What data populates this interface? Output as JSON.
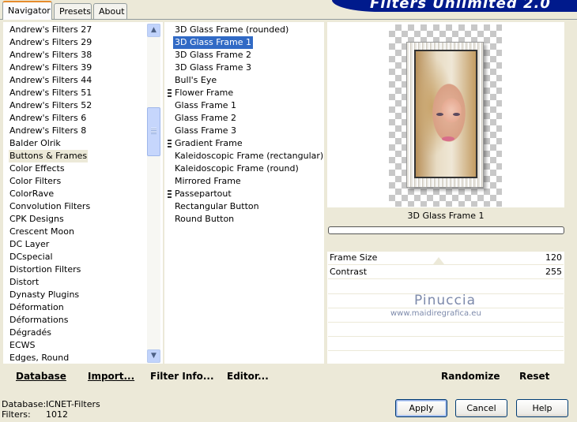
{
  "tabs": [
    "Navigator",
    "Presets",
    "About"
  ],
  "banner_title": "Filters Unlimited 2.0",
  "categories": [
    "Andrew's Filters 27",
    "Andrew's Filters 29",
    "Andrew's Filters 38",
    "Andrew's Filters 39",
    "Andrew's Filters 44",
    "Andrew's Filters 51",
    "Andrew's Filters 52",
    "Andrew's Filters 6",
    "Andrew's Filters 8",
    "Balder Olrik",
    "Buttons & Frames",
    "Color Effects",
    "Color Filters",
    "ColorRave",
    "Convolution Filters",
    "CPK Designs",
    "Crescent Moon",
    "DC Layer",
    "DCspecial",
    "Distortion Filters",
    "Distort",
    "Dynasty Plugins",
    "Déformation",
    "Déformations",
    "Dégradés",
    "ECWS",
    "Edges, Round"
  ],
  "selected_category": "Buttons & Frames",
  "filters": [
    "3D Glass Frame (rounded)",
    "3D Glass Frame 1",
    "3D Glass Frame 2",
    "3D Glass Frame 3",
    "Bull's Eye",
    "Flower Frame",
    "Glass Frame 1",
    "Glass Frame 2",
    "Glass Frame 3",
    "Gradient Frame",
    "Kaleidoscopic Frame (rectangular)",
    "Kaleidoscopic Frame (round)",
    "Mirrored Frame",
    "Passepartout",
    "Rectangular Button",
    "Round Button"
  ],
  "selected_filter": "3D Glass Frame 1",
  "preview_caption": "3D Glass Frame 1",
  "params": [
    {
      "label": "Frame Size",
      "value": "120"
    },
    {
      "label": "Contrast",
      "value": "255"
    }
  ],
  "watermark": {
    "name": "Pinuccia",
    "url": "www.maidiregrafica.eu"
  },
  "left_buttons": {
    "database": "Database",
    "import": "Import...",
    "filter_info": "Filter Info...",
    "editor": "Editor..."
  },
  "right_buttons": {
    "randomize": "Randomize",
    "reset": "Reset"
  },
  "status": {
    "database_label": "Database:",
    "database_value": "ICNET-Filters",
    "filters_label": "Filters:",
    "filters_value": "1012"
  },
  "dialog_buttons": {
    "apply": "Apply",
    "cancel": "Cancel",
    "help": "Help"
  }
}
